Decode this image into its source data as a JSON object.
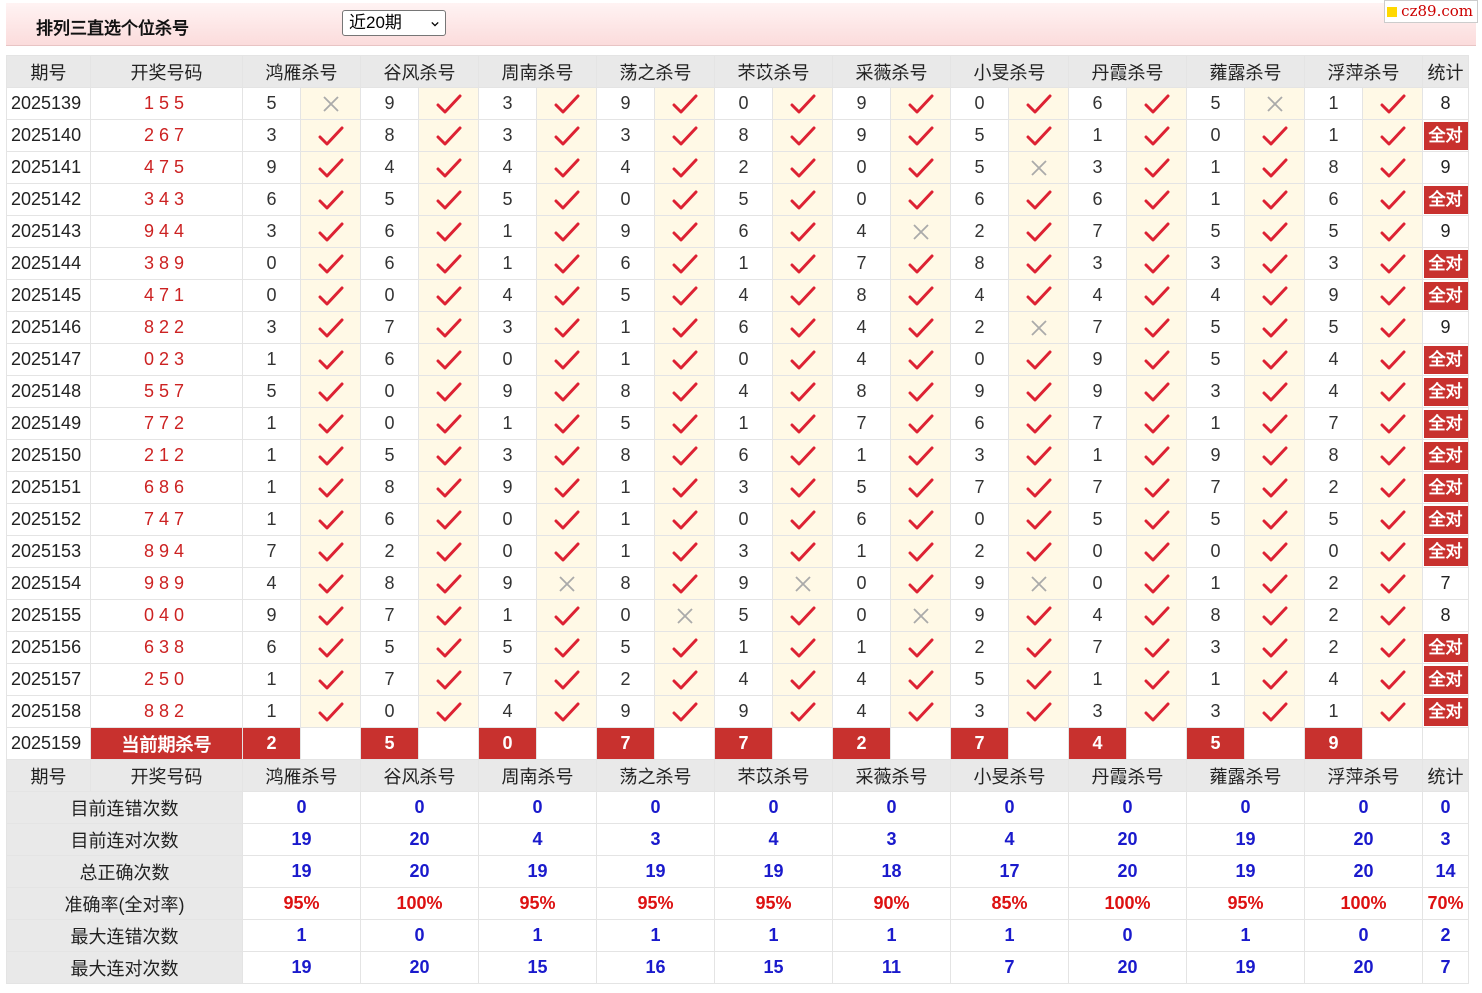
{
  "header": {
    "title": "排列三直选个位杀号",
    "period_select": "近20期",
    "watermark": "cz89.com"
  },
  "columns": {
    "issue": "期号",
    "draw": "开奖号码",
    "stats": "统计",
    "experts": [
      "鸿雁杀号",
      "谷风杀号",
      "周南杀号",
      "荡之杀号",
      "芣苡杀号",
      "采薇杀号",
      "小旻杀号",
      "丹霞杀号",
      "蕹露杀号",
      "浮萍杀号"
    ]
  },
  "all_correct_label": "全对",
  "rows": [
    {
      "issue": "2025139",
      "draw": "155",
      "kills": [
        "5",
        "9",
        "3",
        "9",
        "0",
        "9",
        "0",
        "6",
        "5",
        "1"
      ],
      "hits": [
        0,
        1,
        1,
        1,
        1,
        1,
        1,
        1,
        0,
        1
      ],
      "stat": "8"
    },
    {
      "issue": "2025140",
      "draw": "267",
      "kills": [
        "3",
        "8",
        "3",
        "3",
        "8",
        "9",
        "5",
        "1",
        "0",
        "1"
      ],
      "hits": [
        1,
        1,
        1,
        1,
        1,
        1,
        1,
        1,
        1,
        1
      ],
      "stat": "全对"
    },
    {
      "issue": "2025141",
      "draw": "475",
      "kills": [
        "9",
        "4",
        "4",
        "4",
        "2",
        "0",
        "5",
        "3",
        "1",
        "8"
      ],
      "hits": [
        1,
        1,
        1,
        1,
        1,
        1,
        0,
        1,
        1,
        1
      ],
      "stat": "9"
    },
    {
      "issue": "2025142",
      "draw": "343",
      "kills": [
        "6",
        "5",
        "5",
        "0",
        "5",
        "0",
        "6",
        "6",
        "1",
        "6"
      ],
      "hits": [
        1,
        1,
        1,
        1,
        1,
        1,
        1,
        1,
        1,
        1
      ],
      "stat": "全对"
    },
    {
      "issue": "2025143",
      "draw": "944",
      "kills": [
        "3",
        "6",
        "1",
        "9",
        "6",
        "4",
        "2",
        "7",
        "5",
        "5"
      ],
      "hits": [
        1,
        1,
        1,
        1,
        1,
        0,
        1,
        1,
        1,
        1
      ],
      "stat": "9"
    },
    {
      "issue": "2025144",
      "draw": "389",
      "kills": [
        "0",
        "6",
        "1",
        "6",
        "1",
        "7",
        "8",
        "3",
        "3",
        "3"
      ],
      "hits": [
        1,
        1,
        1,
        1,
        1,
        1,
        1,
        1,
        1,
        1
      ],
      "stat": "全对"
    },
    {
      "issue": "2025145",
      "draw": "471",
      "kills": [
        "0",
        "0",
        "4",
        "5",
        "4",
        "8",
        "4",
        "4",
        "4",
        "9"
      ],
      "hits": [
        1,
        1,
        1,
        1,
        1,
        1,
        1,
        1,
        1,
        1
      ],
      "stat": "全对"
    },
    {
      "issue": "2025146",
      "draw": "822",
      "kills": [
        "3",
        "7",
        "3",
        "1",
        "6",
        "4",
        "2",
        "7",
        "5",
        "5"
      ],
      "hits": [
        1,
        1,
        1,
        1,
        1,
        1,
        0,
        1,
        1,
        1
      ],
      "stat": "9"
    },
    {
      "issue": "2025147",
      "draw": "023",
      "kills": [
        "1",
        "6",
        "0",
        "1",
        "0",
        "4",
        "0",
        "9",
        "5",
        "4"
      ],
      "hits": [
        1,
        1,
        1,
        1,
        1,
        1,
        1,
        1,
        1,
        1
      ],
      "stat": "全对"
    },
    {
      "issue": "2025148",
      "draw": "557",
      "kills": [
        "5",
        "0",
        "9",
        "8",
        "4",
        "8",
        "9",
        "9",
        "3",
        "4"
      ],
      "hits": [
        1,
        1,
        1,
        1,
        1,
        1,
        1,
        1,
        1,
        1
      ],
      "stat": "全对"
    },
    {
      "issue": "2025149",
      "draw": "772",
      "kills": [
        "1",
        "0",
        "1",
        "5",
        "1",
        "7",
        "6",
        "7",
        "1",
        "7"
      ],
      "hits": [
        1,
        1,
        1,
        1,
        1,
        1,
        1,
        1,
        1,
        1
      ],
      "stat": "全对"
    },
    {
      "issue": "2025150",
      "draw": "212",
      "kills": [
        "1",
        "5",
        "3",
        "8",
        "6",
        "1",
        "3",
        "1",
        "9",
        "8"
      ],
      "hits": [
        1,
        1,
        1,
        1,
        1,
        1,
        1,
        1,
        1,
        1
      ],
      "stat": "全对"
    },
    {
      "issue": "2025151",
      "draw": "686",
      "kills": [
        "1",
        "8",
        "9",
        "1",
        "3",
        "5",
        "7",
        "7",
        "7",
        "2"
      ],
      "hits": [
        1,
        1,
        1,
        1,
        1,
        1,
        1,
        1,
        1,
        1
      ],
      "stat": "全对"
    },
    {
      "issue": "2025152",
      "draw": "747",
      "kills": [
        "1",
        "6",
        "0",
        "1",
        "0",
        "6",
        "0",
        "5",
        "5",
        "5"
      ],
      "hits": [
        1,
        1,
        1,
        1,
        1,
        1,
        1,
        1,
        1,
        1
      ],
      "stat": "全对"
    },
    {
      "issue": "2025153",
      "draw": "894",
      "kills": [
        "7",
        "2",
        "0",
        "1",
        "3",
        "1",
        "2",
        "0",
        "0",
        "0"
      ],
      "hits": [
        1,
        1,
        1,
        1,
        1,
        1,
        1,
        1,
        1,
        1
      ],
      "stat": "全对"
    },
    {
      "issue": "2025154",
      "draw": "989",
      "kills": [
        "4",
        "8",
        "9",
        "8",
        "9",
        "0",
        "9",
        "0",
        "1",
        "2"
      ],
      "hits": [
        1,
        1,
        0,
        1,
        0,
        1,
        0,
        1,
        1,
        1
      ],
      "stat": "7"
    },
    {
      "issue": "2025155",
      "draw": "040",
      "kills": [
        "9",
        "7",
        "1",
        "0",
        "5",
        "0",
        "9",
        "4",
        "8",
        "2"
      ],
      "hits": [
        1,
        1,
        1,
        0,
        1,
        0,
        1,
        1,
        1,
        1
      ],
      "stat": "8"
    },
    {
      "issue": "2025156",
      "draw": "638",
      "kills": [
        "6",
        "5",
        "5",
        "5",
        "1",
        "1",
        "2",
        "7",
        "3",
        "2"
      ],
      "hits": [
        1,
        1,
        1,
        1,
        1,
        1,
        1,
        1,
        1,
        1
      ],
      "stat": "全对"
    },
    {
      "issue": "2025157",
      "draw": "250",
      "kills": [
        "1",
        "7",
        "7",
        "2",
        "4",
        "4",
        "5",
        "1",
        "1",
        "4"
      ],
      "hits": [
        1,
        1,
        1,
        1,
        1,
        1,
        1,
        1,
        1,
        1
      ],
      "stat": "全对"
    },
    {
      "issue": "2025158",
      "draw": "882",
      "kills": [
        "1",
        "0",
        "4",
        "9",
        "9",
        "4",
        "3",
        "3",
        "3",
        "1"
      ],
      "hits": [
        1,
        1,
        1,
        1,
        1,
        1,
        1,
        1,
        1,
        1
      ],
      "stat": "全对"
    }
  ],
  "current": {
    "issue": "2025159",
    "label": "当前期杀号",
    "kills": [
      "2",
      "5",
      "0",
      "7",
      "7",
      "2",
      "7",
      "4",
      "5",
      "9"
    ]
  },
  "stats": [
    {
      "label": "目前连错次数",
      "values": [
        "0",
        "0",
        "0",
        "0",
        "0",
        "0",
        "0",
        "0",
        "0",
        "0"
      ],
      "total": "0"
    },
    {
      "label": "目前连对次数",
      "values": [
        "19",
        "20",
        "4",
        "3",
        "4",
        "3",
        "4",
        "20",
        "19",
        "20"
      ],
      "total": "3"
    },
    {
      "label": "总正确次数",
      "values": [
        "19",
        "20",
        "19",
        "19",
        "19",
        "18",
        "17",
        "20",
        "19",
        "20"
      ],
      "total": "14"
    },
    {
      "label": "准确率(全对率)",
      "values": [
        "95%",
        "100%",
        "95%",
        "95%",
        "95%",
        "90%",
        "85%",
        "100%",
        "95%",
        "100%"
      ],
      "total": "70%"
    },
    {
      "label": "最大连错次数",
      "values": [
        "1",
        "0",
        "1",
        "1",
        "1",
        "1",
        "1",
        "0",
        "1",
        "0"
      ],
      "total": "2"
    },
    {
      "label": "最大连对次数",
      "values": [
        "19",
        "20",
        "15",
        "16",
        "15",
        "11",
        "7",
        "20",
        "19",
        "20"
      ],
      "total": "7"
    }
  ],
  "colors": {
    "red": "#c8312e",
    "check": "#dd2233",
    "cross": "#aaaaaa",
    "blue": "#1a1acc"
  }
}
